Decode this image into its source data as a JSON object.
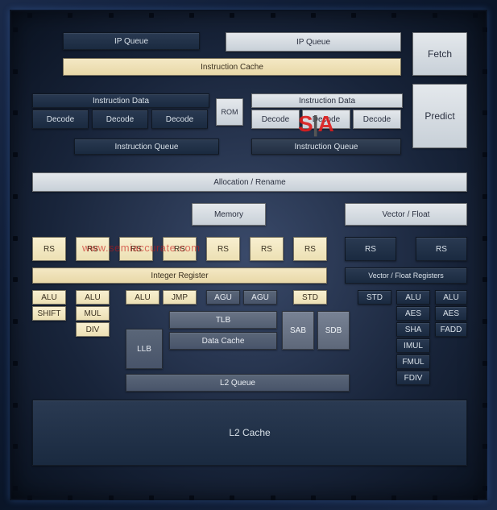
{
  "watermark": {
    "logo_s": "S",
    "logo_sep": "|",
    "logo_a": "A",
    "url": "www.semiaccurate.com"
  },
  "fetch": {
    "ip_queue": "IP Queue",
    "icache": "Instruction Cache",
    "fetch": "Fetch"
  },
  "decode": {
    "idata": "Instruction Data",
    "rom": "ROM",
    "d": "Decode",
    "iq": "Instruction Queue",
    "predict": "Predict"
  },
  "rename": {
    "alloc": "Allocation / Rename",
    "memory": "Memory",
    "vf": "Vector / Float"
  },
  "int": {
    "rs": "RS",
    "ireg": "Integer Register",
    "alu": "ALU",
    "shift": "SHIFT",
    "mul": "MUL",
    "div": "DIV",
    "jmp": "JMP",
    "agu": "AGU",
    "std": "STD"
  },
  "mem": {
    "tlb": "TLB",
    "dcache": "Data Cache",
    "llb": "LLB",
    "sab": "SAB",
    "sdb": "SDB",
    "l2q": "L2 Queue"
  },
  "vec": {
    "rs": "RS",
    "vfreg": "Vector / Float Registers",
    "std": "STD",
    "alu": "ALU",
    "aes": "AES",
    "sha": "SHA",
    "imul": "IMUL",
    "fmul": "FMUL",
    "fdiv": "FDIV",
    "fadd": "FADD"
  },
  "l2": {
    "cache": "L2 Cache"
  }
}
